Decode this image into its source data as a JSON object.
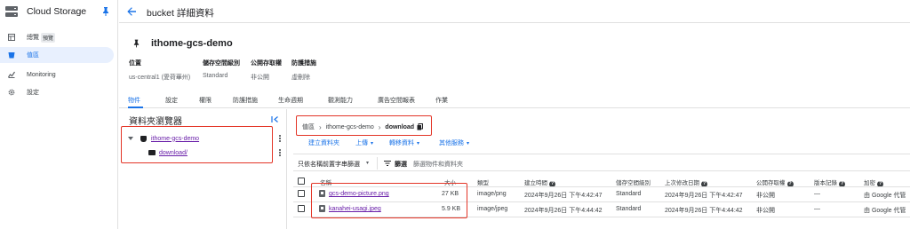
{
  "sidenav": {
    "title": "Cloud Storage",
    "items": [
      {
        "label": "總覽",
        "badge": "預覽"
      },
      {
        "label": "值區"
      },
      {
        "label": "Monitoring"
      },
      {
        "label": "設定"
      }
    ]
  },
  "header": {
    "title": "bucket 詳細資料"
  },
  "bucket": {
    "name": "ithome-gcs-demo",
    "properties": [
      {
        "key": "位置",
        "value": "us-central1 (愛荷華州)"
      },
      {
        "key": "儲存空間級別",
        "value": "Standard"
      },
      {
        "key": "公開存取權",
        "value": "非公開"
      },
      {
        "key": "防護措施",
        "value": "虛刪除"
      }
    ]
  },
  "tabs": [
    "物件",
    "設定",
    "權限",
    "防護措施",
    "生命週期",
    "觀測能力",
    "廣告空間報表",
    "作業"
  ],
  "folder_browser": {
    "title": "資料夾瀏覽器",
    "bucket": "ithome-gcs-demo",
    "folder": "download/"
  },
  "breadcrumb": {
    "root": "值區",
    "bucket": "ithome-gcs-demo",
    "current": "download"
  },
  "actions": [
    "建立資料夾",
    "上傳",
    "轉移資料",
    "其他服務"
  ],
  "filter": {
    "select": "只依名稱前置字串篩選",
    "label": "篩選",
    "placeholder": "篩選物件和資料夾"
  },
  "table": {
    "columns": [
      "名稱",
      "大小",
      "類型",
      "建立時間",
      "儲存空間級別",
      "上次修改日期",
      "公開存取權",
      "版本記錄",
      "加密"
    ],
    "rows": [
      {
        "name": "gcs-demo-picture.png",
        "size": "27 KB",
        "type": "image/png",
        "created": "2024年9月26日 下午4:42:47",
        "class": "Standard",
        "modified": "2024年9月26日 下午4:42:47",
        "public": "非公開",
        "version": "—",
        "encryption": "由 Google 代管"
      },
      {
        "name": "kanahei-usagi.jpeg",
        "size": "5.9 KB",
        "type": "image/jpeg",
        "created": "2024年9月26日 下午4:44:42",
        "class": "Standard",
        "modified": "2024年9月26日 下午4:44:42",
        "public": "非公開",
        "version": "—",
        "encryption": "由 Google 代管"
      }
    ]
  },
  "colors": {
    "accent": "#1a73e8",
    "highlight": "#e33527",
    "visited_link": "#681da8"
  },
  "icons": [
    "storage-logo-icon",
    "pin-icon",
    "back-arrow-icon",
    "overview-icon",
    "bucket-icon",
    "monitoring-icon",
    "settings-gear-icon",
    "collapse-panel-icon",
    "kebab-menu-icon",
    "folder-icon",
    "copy-icon",
    "filter-icon",
    "help-icon",
    "file-image-icon"
  ]
}
